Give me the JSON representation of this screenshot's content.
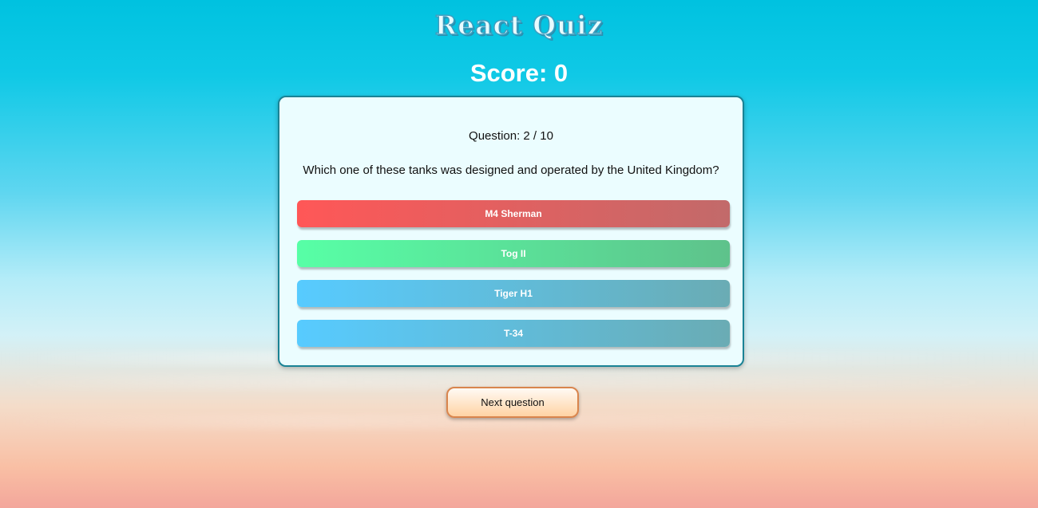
{
  "app": {
    "title": "React Quiz",
    "score_label": "Score: 0"
  },
  "question": {
    "label": "Question: 2 / 10",
    "text": "Which one of these tanks was designed and operated by the United Kingdom?"
  },
  "answers": [
    {
      "label": "M4 Sherman",
      "color_start": "#ff5757",
      "color_end": "#c26a6a"
    },
    {
      "label": "Tog II",
      "color_start": "#57ffa6",
      "color_end": "#5ec28b"
    },
    {
      "label": "Tiger H1",
      "color_start": "#57cbff",
      "color_end": "#6aacb4"
    },
    {
      "label": "T-34",
      "color_start": "#57cbff",
      "color_end": "#6aacb4"
    }
  ],
  "controls": {
    "next_label": "Next question"
  },
  "colors": {
    "card_border": "#1a8395",
    "card_background": "#ebfdff",
    "next_border": "#d9854d"
  }
}
